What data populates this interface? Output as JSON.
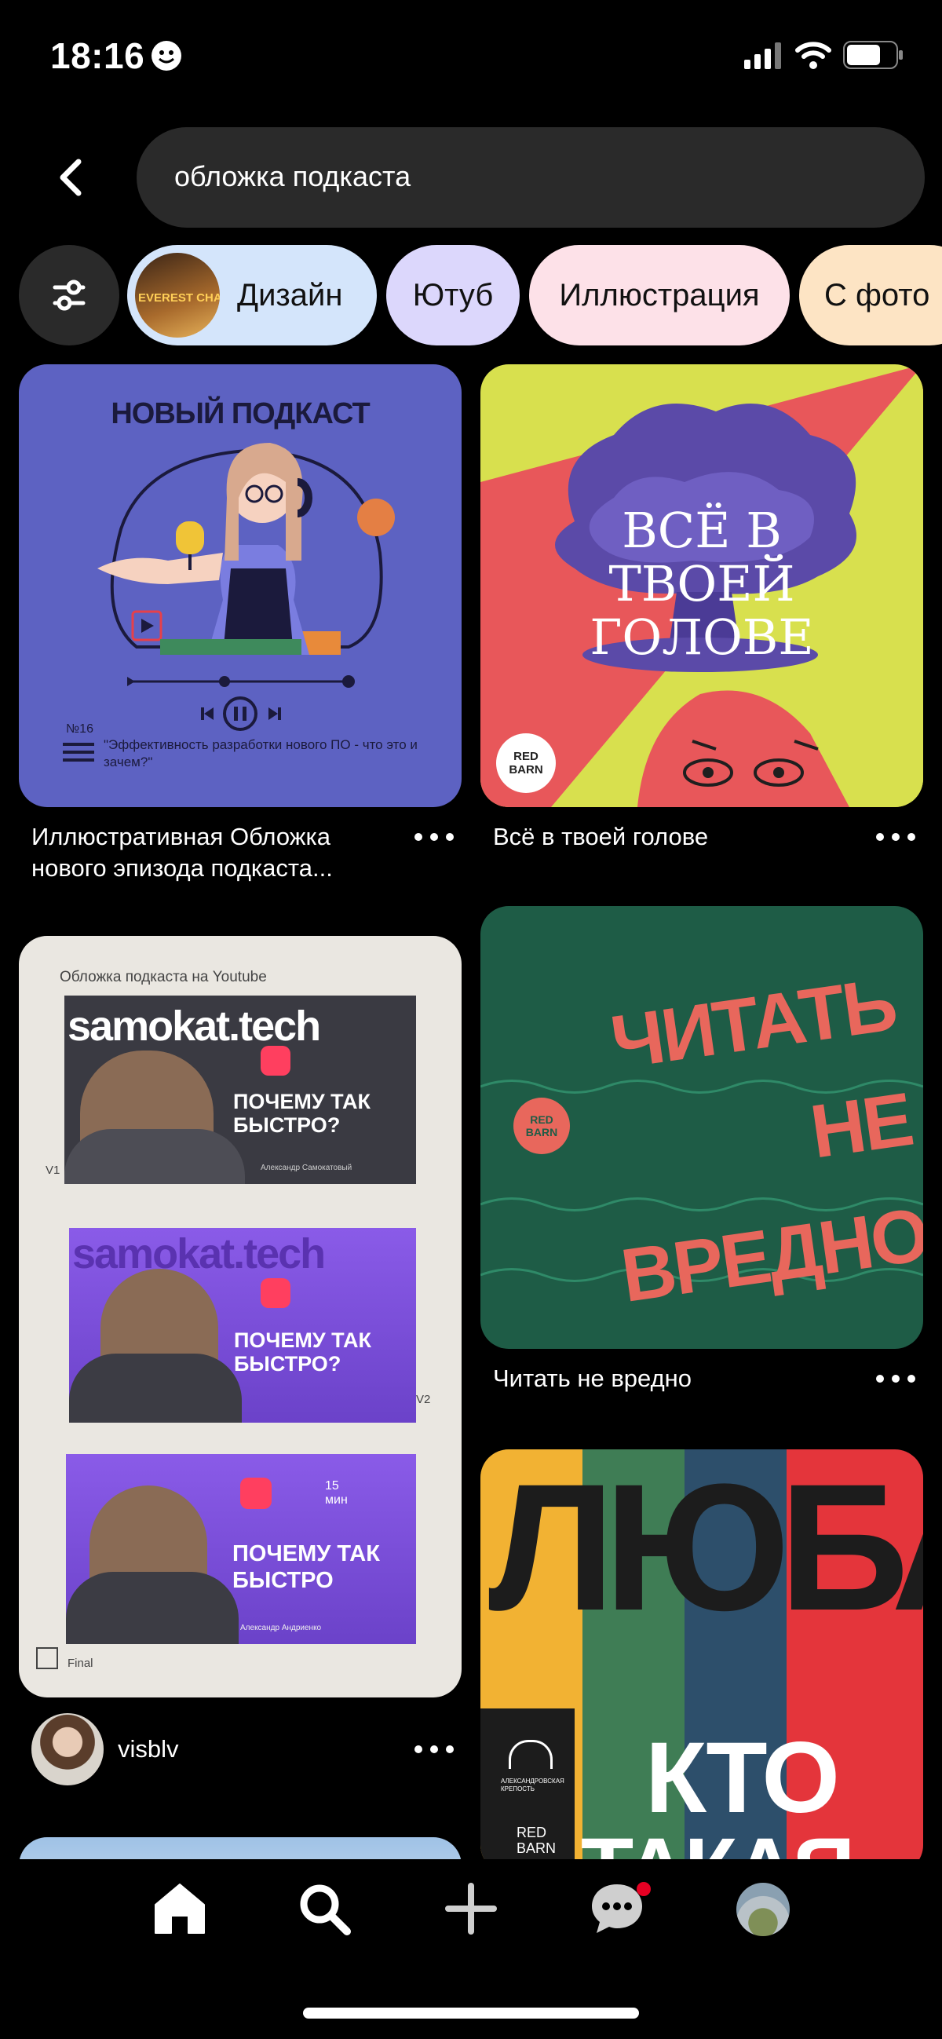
{
  "status": {
    "time": "18:16"
  },
  "search": {
    "query": "обложка подкаста"
  },
  "chips": [
    {
      "label": "Дизайн",
      "thumb_text": "EVEREST CHAMP",
      "bg": "#d4e5fb"
    },
    {
      "label": "Ютуб",
      "bg": "#dcd7fc"
    },
    {
      "label": "Иллюстрация",
      "bg": "#fde1e8"
    },
    {
      "label": "С фото",
      "bg": "#fde4c4"
    }
  ],
  "pins": {
    "pin1": {
      "title": "Иллюстративная Обложка нового эпизода подкаста...",
      "header": "НОВЫЙ ПОДКАСТ",
      "episode_no": "№16",
      "episode_desc": "\"Эффективность разработки нового ПО - что это и зачем?\""
    },
    "pin2": {
      "title": "Всё в твоей голове",
      "art_text": "ВСЁ В ТВОЕЙ ГОЛОВЕ",
      "badge": "RED BARN"
    },
    "pin3": {
      "user": "visblv",
      "caption": "Обложка подкаста на Youtube",
      "brand": "samokat.tech",
      "headline1": "ПОЧЕМУ ТАК БЫСТРО?",
      "headline3": "ПОЧЕМУ ТАК БЫСТРО",
      "author1": "Александр Самокатовый",
      "author3": "Александр Андриенко",
      "v1": "V1",
      "v2": "V2",
      "final": "Final",
      "mins": "15 мин"
    },
    "pin4": {
      "title": "Читать не вредно",
      "art_text": "ЧИТАТЬ НЕ ВРЕДНО",
      "badge": "RED BARN"
    },
    "pin5": {
      "art_top": "ЛЮБА",
      "art_mid": "КТО",
      "art_bottom": "ТАКАЯ",
      "badge": "RED BARN",
      "venue": "АЛЕКСАНДРОВСКАЯ КРЕПОСТЬ"
    }
  },
  "nav": {
    "items": [
      "home",
      "search",
      "create",
      "messages",
      "profile"
    ],
    "notification_color": "#e60023"
  }
}
